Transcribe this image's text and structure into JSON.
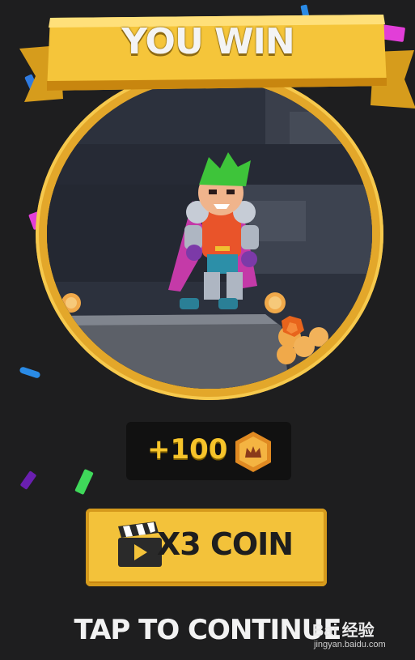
{
  "banner": {
    "title": "YOU WIN"
  },
  "reward": {
    "amount_text": "+100",
    "currency_icon": "crown-coin-icon"
  },
  "x3_button": {
    "label": "X3 COIN",
    "icon": "clapperboard-icon"
  },
  "continue": {
    "label": "TAP TO CONTINUE"
  },
  "watermark": {
    "brand": "Bai 经验",
    "site": "jingyan.baidu.com"
  },
  "colors": {
    "gold": "#f3c23a",
    "background": "#1e1e1f",
    "text_gold": "#f6c42a"
  }
}
